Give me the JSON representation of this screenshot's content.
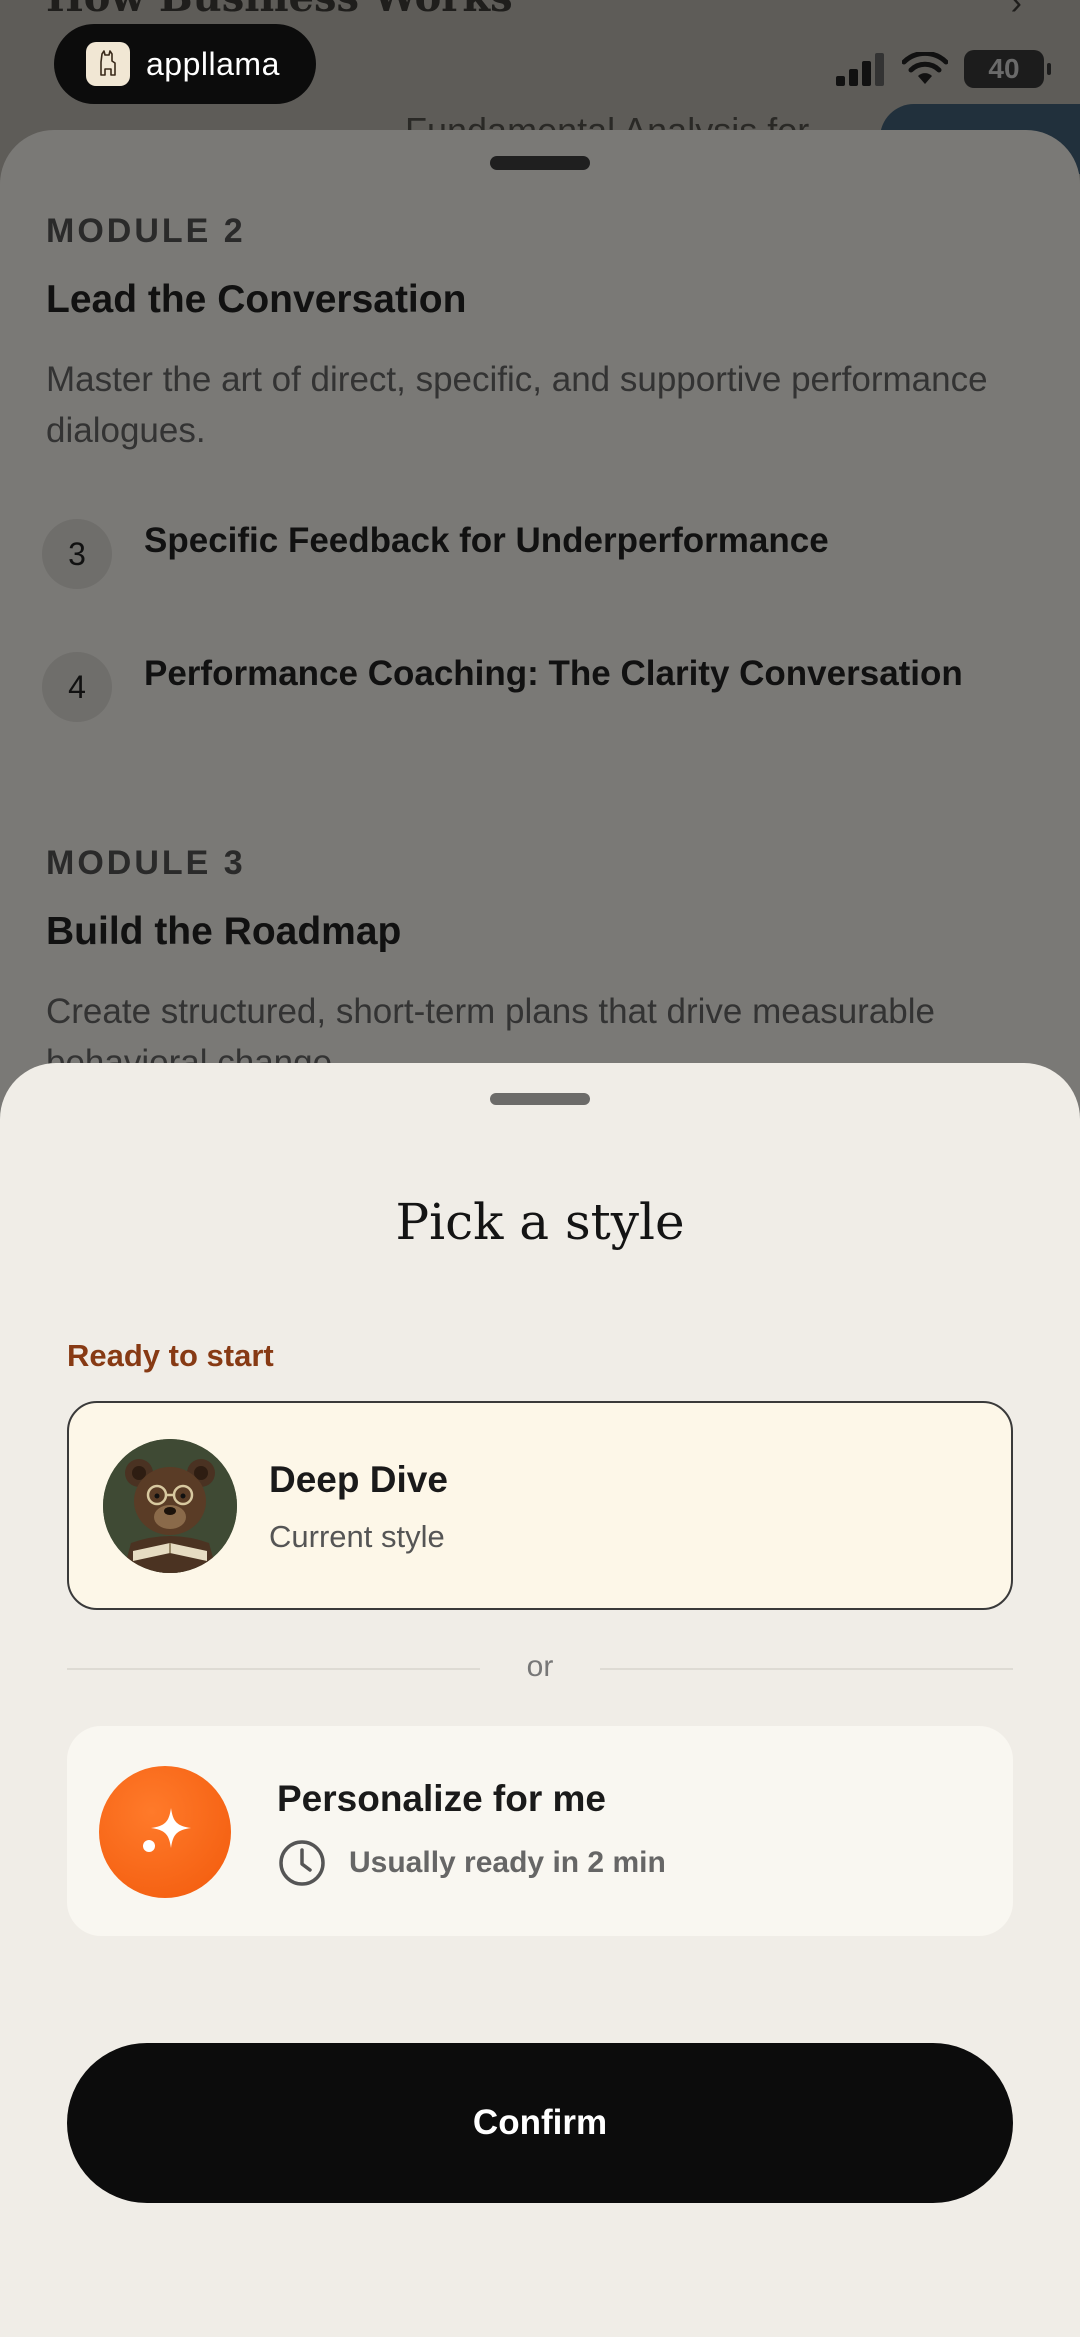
{
  "background": {
    "peek_title": "How Business Works",
    "peek_subtitle": "Fundamental Analysis for",
    "status_bar": {
      "app_name": "appllama",
      "battery": "40"
    },
    "modules": [
      {
        "label": "MODULE 2",
        "title": "Lead the Conversation",
        "description": "Master the art of direct, specific, and supportive performance dialogues.",
        "lessons": [
          {
            "number": "3",
            "title": "Specific Feedback for Underperformance"
          },
          {
            "number": "4",
            "title": "Performance Coaching: The Clarity Conversation"
          }
        ]
      },
      {
        "label": "MODULE 3",
        "title": "Build the Roadmap",
        "description": "Create structured, short-term plans that drive measurable behavioral change."
      }
    ]
  },
  "sheet": {
    "title": "Pick a style",
    "section_label": "Ready to start",
    "current_style": {
      "name": "Deep Dive",
      "subtitle": "Current style"
    },
    "or_text": "or",
    "personalize": {
      "title": "Personalize for me",
      "time": "Usually ready in 2 min"
    },
    "confirm_label": "Confirm"
  },
  "colors": {
    "accent_orange": "#f25a0c",
    "section_label": "#873a14",
    "card_selected_bg": "#fdf7e8",
    "sheet_bg": "#f0ede7",
    "button_bg": "#0c0c0c"
  }
}
